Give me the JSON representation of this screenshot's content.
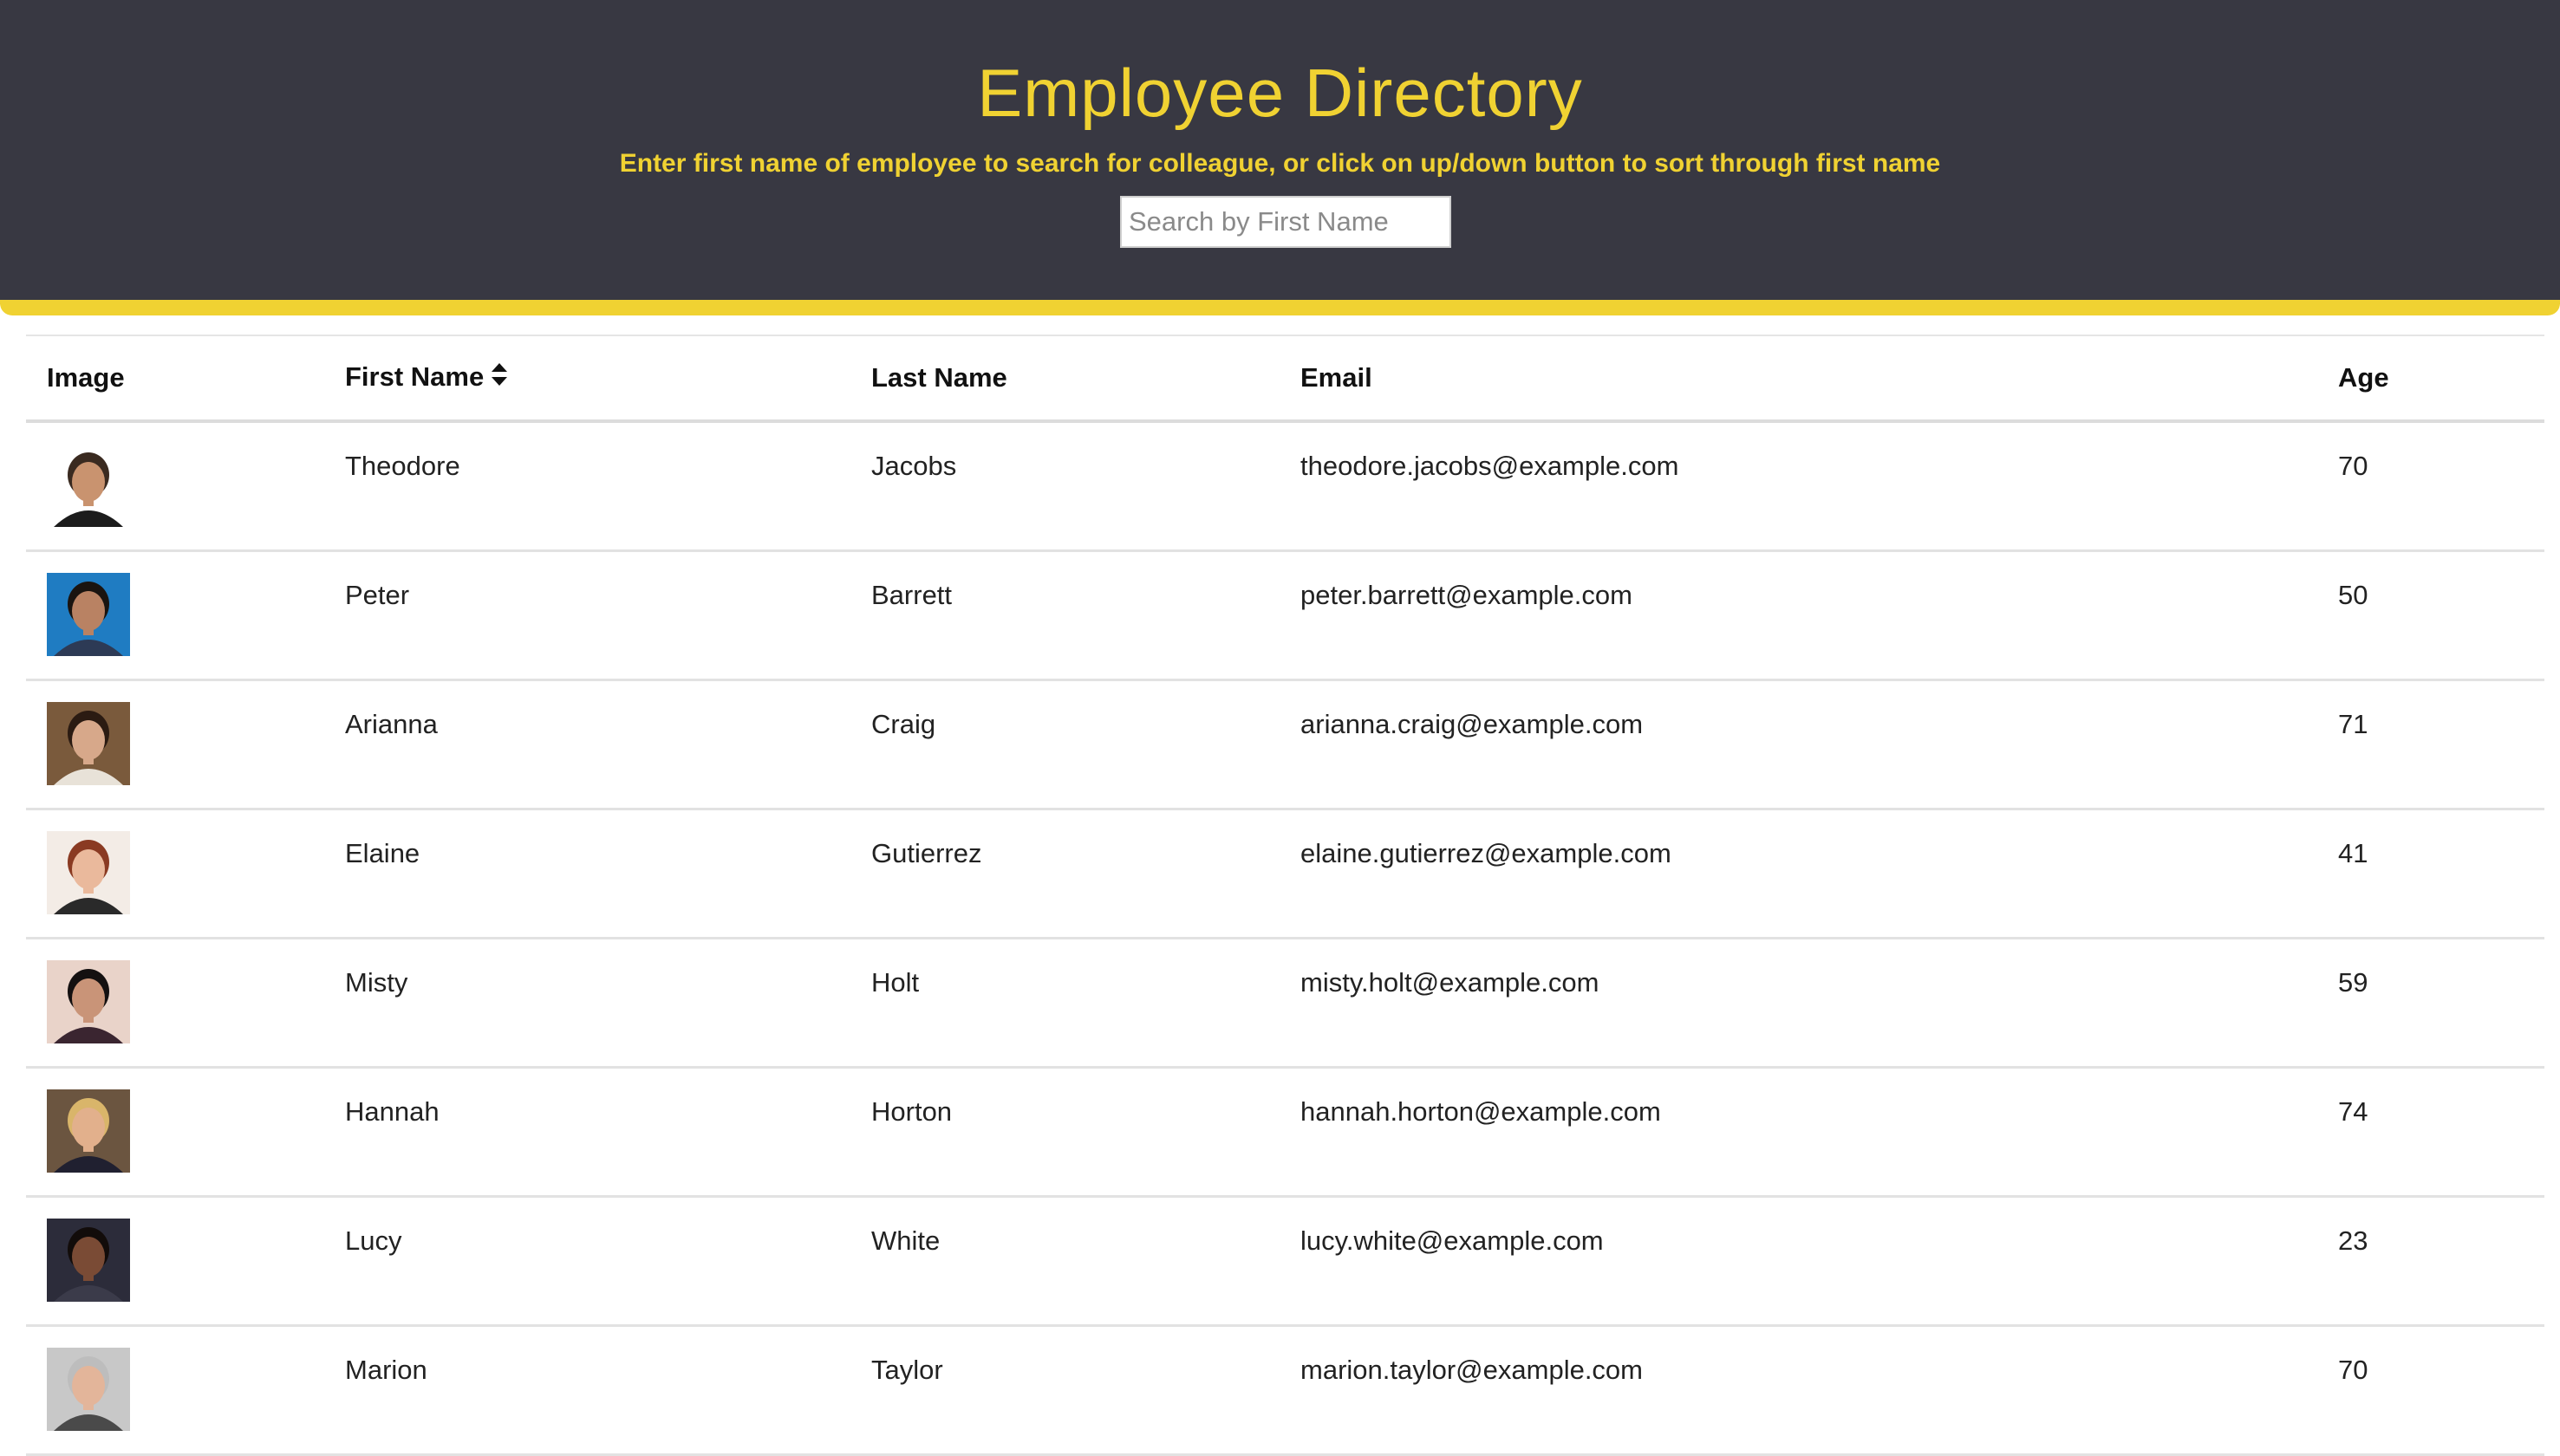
{
  "header": {
    "title": "Employee Directory",
    "subtitle": "Enter first name of employee to search for colleague, or click on up/down button to sort through first name",
    "search_placeholder": "Search by First Name",
    "search_value": "",
    "accent_color": "#f0d232",
    "background_color": "#383842"
  },
  "table": {
    "columns": {
      "image": "Image",
      "first_name": "First Name",
      "last_name": "Last Name",
      "email": "Email",
      "age": "Age"
    },
    "sort_icon": "sort-up-down-icon",
    "rows": [
      {
        "first": "Theodore",
        "last": "Jacobs",
        "email": "theodore.jacobs@example.com",
        "age": "70",
        "avatar": "avatar-photo",
        "skin": "#c9936f",
        "bg": "#ffffff",
        "hair": "#3a2a20",
        "shirt": "#1c1c1c"
      },
      {
        "first": "Peter",
        "last": "Barrett",
        "email": "peter.barrett@example.com",
        "age": "50",
        "avatar": "avatar-photo",
        "skin": "#b98263",
        "bg": "#1f7cc2",
        "hair": "#1a1410",
        "shirt": "#2d3a55"
      },
      {
        "first": "Arianna",
        "last": "Craig",
        "email": "arianna.craig@example.com",
        "age": "71",
        "avatar": "avatar-photo",
        "skin": "#d7a88a",
        "bg": "#7a5a3c",
        "hair": "#2b1b12",
        "shirt": "#e8e2d8"
      },
      {
        "first": "Elaine",
        "last": "Gutierrez",
        "email": "elaine.gutierrez@example.com",
        "age": "41",
        "avatar": "avatar-photo",
        "skin": "#eab99c",
        "bg": "#f3ece6",
        "hair": "#8a3a22",
        "shirt": "#2a2a2a"
      },
      {
        "first": "Misty",
        "last": "Holt",
        "email": "misty.holt@example.com",
        "age": "59",
        "avatar": "avatar-photo",
        "skin": "#c99478",
        "bg": "#e9d3c9",
        "hair": "#141010",
        "shirt": "#3a2530"
      },
      {
        "first": "Hannah",
        "last": "Horton",
        "email": "hannah.horton@example.com",
        "age": "74",
        "avatar": "avatar-photo",
        "skin": "#e2b08c",
        "bg": "#6b5540",
        "hair": "#d9b56a",
        "shirt": "#202030"
      },
      {
        "first": "Lucy",
        "last": "White",
        "email": "lucy.white@example.com",
        "age": "23",
        "avatar": "avatar-photo",
        "skin": "#7a4b35",
        "bg": "#2c2c3a",
        "hair": "#120c0a",
        "shirt": "#3b3b4a"
      },
      {
        "first": "Marion",
        "last": "Taylor",
        "email": "marion.taylor@example.com",
        "age": "70",
        "avatar": "avatar-photo",
        "skin": "#e3b59a",
        "bg": "#c8c8c8",
        "hair": "#bdbdbd",
        "shirt": "#4a4a4a"
      }
    ]
  }
}
